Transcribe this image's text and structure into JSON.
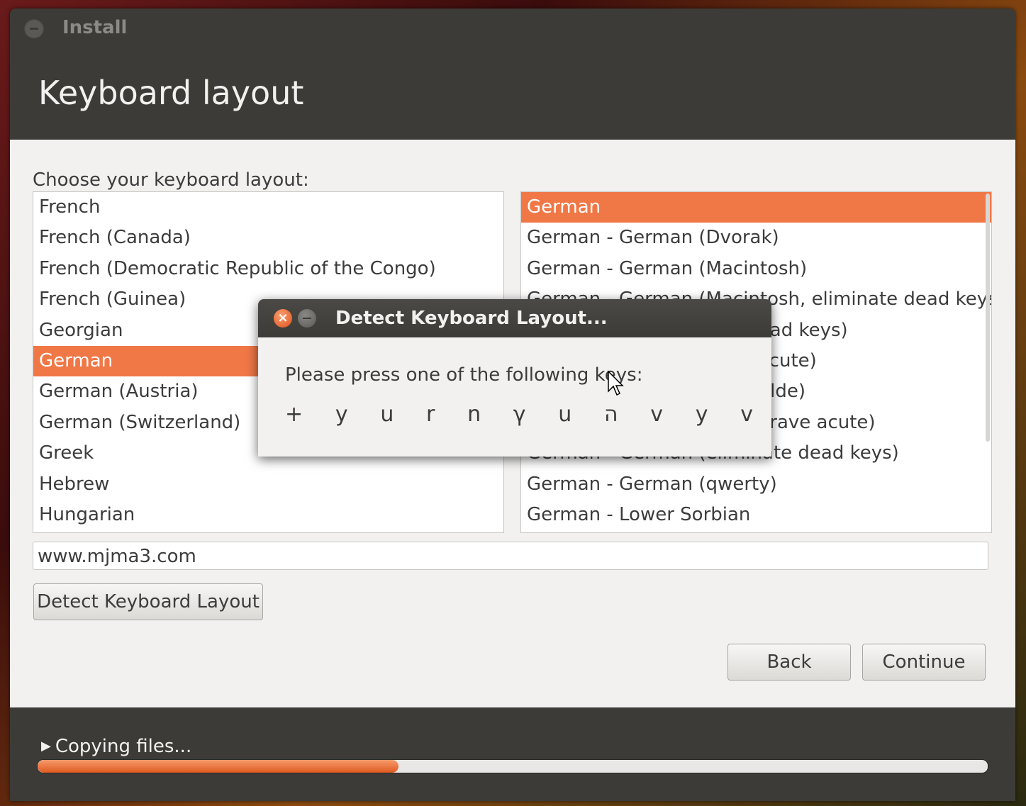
{
  "window": {
    "title": "Install",
    "header_title": "Keyboard layout"
  },
  "content": {
    "prompt": "Choose your keyboard layout:",
    "left_list": [
      {
        "label": "French"
      },
      {
        "label": "French (Canada)"
      },
      {
        "label": "French (Democratic Republic of the Congo)"
      },
      {
        "label": "French (Guinea)"
      },
      {
        "label": "Georgian"
      },
      {
        "label": "German",
        "selected": true
      },
      {
        "label": "German (Austria)"
      },
      {
        "label": "German (Switzerland)"
      },
      {
        "label": "Greek"
      },
      {
        "label": "Hebrew"
      },
      {
        "label": "Hungarian"
      }
    ],
    "right_list": [
      {
        "label": "German",
        "selected": true
      },
      {
        "label": "German - German (Dvorak)"
      },
      {
        "label": "German - German (Macintosh)"
      },
      {
        "label": "German - German (Macintosh, eliminate dead keys)"
      },
      {
        "label": "German - German (Sun dead keys)"
      },
      {
        "label": "German - German (dead acute)"
      },
      {
        "label": "German - German (dead tilde)"
      },
      {
        "label": "German - German (dead grave acute)"
      },
      {
        "label": "German - German (eliminate dead keys)"
      },
      {
        "label": "German - German (qwerty)"
      },
      {
        "label": "German - Lower Sorbian"
      }
    ],
    "test_field_value": "www.mjma3.com",
    "detect_button": "Detect Keyboard Layout",
    "back_button": "Back",
    "continue_button": "Continue"
  },
  "footer": {
    "status": "Copying files...",
    "progress": 0.38
  },
  "dialog": {
    "title": "Detect Keyboard Layout...",
    "prompt": "Please press one of the following keys:",
    "keys": [
      "+",
      "y",
      "u",
      "r",
      "n",
      "γ",
      "u",
      "ה",
      "v",
      "y",
      "v"
    ]
  },
  "colors": {
    "accent": "#f07746",
    "dark": "#3c3b37",
    "light_bg": "#f2f1f0"
  }
}
